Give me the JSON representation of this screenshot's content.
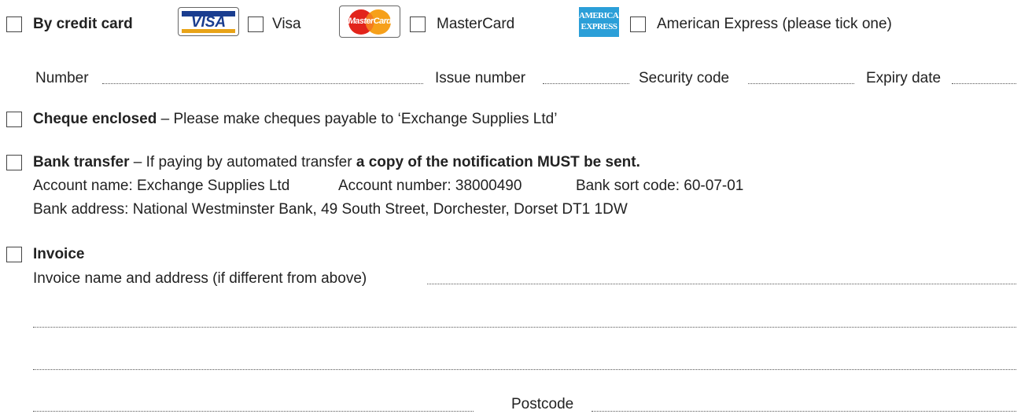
{
  "credit_card": {
    "label": "By credit card",
    "visa_logo_text": "VISA",
    "visa_label": "Visa",
    "mastercard_logo_text": "MasterCard",
    "mastercard_label": "MasterCard",
    "amex_logo_line1": "AMERICAN",
    "amex_logo_line2": "EXPRESS",
    "amex_label": "American Express (please tick one)",
    "fields": {
      "number": "Number",
      "issue_number": "Issue number",
      "security_code": "Security code",
      "expiry_date": "Expiry date"
    }
  },
  "cheque": {
    "label": "Cheque enclosed",
    "text": " – Please make cheques payable to ‘Exchange Supplies Ltd’"
  },
  "bank_transfer": {
    "label": "Bank transfer",
    "text": " – If paying by automated transfer ",
    "emphasis": "a copy of the notification MUST be sent.",
    "account_name": "Account name: Exchange Supplies Ltd",
    "account_number": "Account number: 38000490",
    "sort_code": "Bank sort code: 60-07-01",
    "bank_address": "Bank address: National Westminster Bank, 49 South Street, Dorchester, Dorset  DT1 1DW"
  },
  "invoice": {
    "label": "Invoice",
    "address_label": "Invoice name and address (if different from above)",
    "postcode_label": "Postcode"
  },
  "colors": {
    "visa_blue": "#1a3d8f",
    "visa_gold": "#e8a317",
    "mastercard_red": "#e2241b",
    "mastercard_orange": "#f6a01a",
    "amex_blue": "#2b9fd8"
  }
}
